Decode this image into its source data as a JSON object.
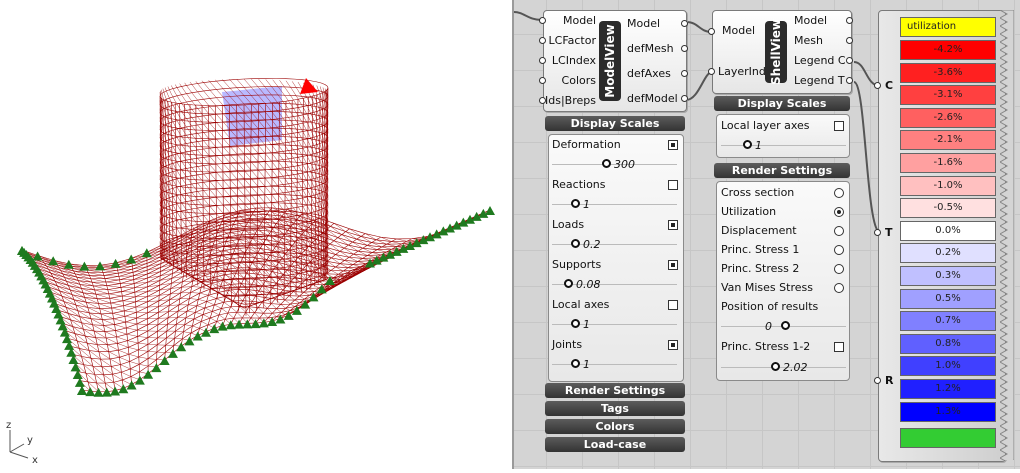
{
  "viewport": {
    "axis_z": "z",
    "axis_y": "y",
    "axis_x": "x"
  },
  "modelview": {
    "nickname": "ModelView",
    "inputs": [
      "Model",
      "LCFactor",
      "LCIndex",
      "Colors",
      "Ids|Breps"
    ],
    "outputs": [
      "Model",
      "defMesh",
      "defAxes",
      "defModel"
    ],
    "display_scales_label": "Display Scales",
    "scales": [
      {
        "label": "Deformation",
        "checked": true,
        "value": "300",
        "level": 0.42
      },
      {
        "label": "Reactions",
        "checked": false,
        "value": "1",
        "level": 0.16
      },
      {
        "label": "Loads",
        "checked": true,
        "value": "0.2",
        "level": 0.16
      },
      {
        "label": "Supports",
        "checked": true,
        "value": "0.08",
        "level": 0.1
      },
      {
        "label": "Local axes",
        "checked": false,
        "value": "1",
        "level": 0.16
      },
      {
        "label": "Joints",
        "checked": true,
        "value": "1",
        "level": 0.16
      }
    ],
    "bars": [
      "Render Settings",
      "Tags",
      "Colors",
      "Load-case"
    ]
  },
  "shellview": {
    "nickname": "ShellView",
    "inputs": [
      "Model",
      "LayerInd"
    ],
    "outputs": [
      "Model",
      "Mesh",
      "Legend C",
      "Legend T"
    ],
    "display_scales_label": "Display Scales",
    "local_layer_axes": {
      "label": "Local layer axes",
      "checked": false,
      "value": "1",
      "level": 0.18
    },
    "render_settings_label": "Render Settings",
    "options": [
      {
        "label": "Cross section",
        "selected": false
      },
      {
        "label": "Utilization",
        "selected": true
      },
      {
        "label": "Displacement",
        "selected": false
      },
      {
        "label": "Princ. Stress 1",
        "selected": false
      },
      {
        "label": "Princ. Stress 2",
        "selected": false
      },
      {
        "label": "Van Mises Stress",
        "selected": false
      }
    ],
    "position_label": "Position of results",
    "position_value": "0",
    "position_level": 0.5,
    "princ12": {
      "label": "Princ. Stress 1-2",
      "checked": false,
      "value": "2.02",
      "level": 0.42
    }
  },
  "legend": {
    "inputs": [
      "C",
      "T",
      "R"
    ],
    "title": "utilization",
    "title_color": "#ffff00",
    "rows": [
      {
        "text": "-4.2%",
        "color": "#ff0000"
      },
      {
        "text": "-3.6%",
        "color": "#ff2020"
      },
      {
        "text": "-3.1%",
        "color": "#ff4040"
      },
      {
        "text": "-2.6%",
        "color": "#ff6060"
      },
      {
        "text": "-2.1%",
        "color": "#ff8080"
      },
      {
        "text": "-1.6%",
        "color": "#ffa0a0"
      },
      {
        "text": "-1.0%",
        "color": "#ffc0c0"
      },
      {
        "text": "-0.5%",
        "color": "#ffe0e0"
      },
      {
        "text": "0.0%",
        "color": "#ffffff"
      },
      {
        "text": "0.2%",
        "color": "#e0e0ff"
      },
      {
        "text": "0.3%",
        "color": "#c0c0ff"
      },
      {
        "text": "0.5%",
        "color": "#a0a0ff"
      },
      {
        "text": "0.7%",
        "color": "#8080ff"
      },
      {
        "text": "0.8%",
        "color": "#6060ff"
      },
      {
        "text": "1.0%",
        "color": "#4040ff"
      },
      {
        "text": "1.2%",
        "color": "#2020ff"
      },
      {
        "text": "1.3%",
        "color": "#0000ff"
      }
    ],
    "footer_color": "#33cc33"
  },
  "colors": {
    "mesh": "#9b0000",
    "support": "#1f7a1f",
    "highlight": "#8080ff"
  }
}
